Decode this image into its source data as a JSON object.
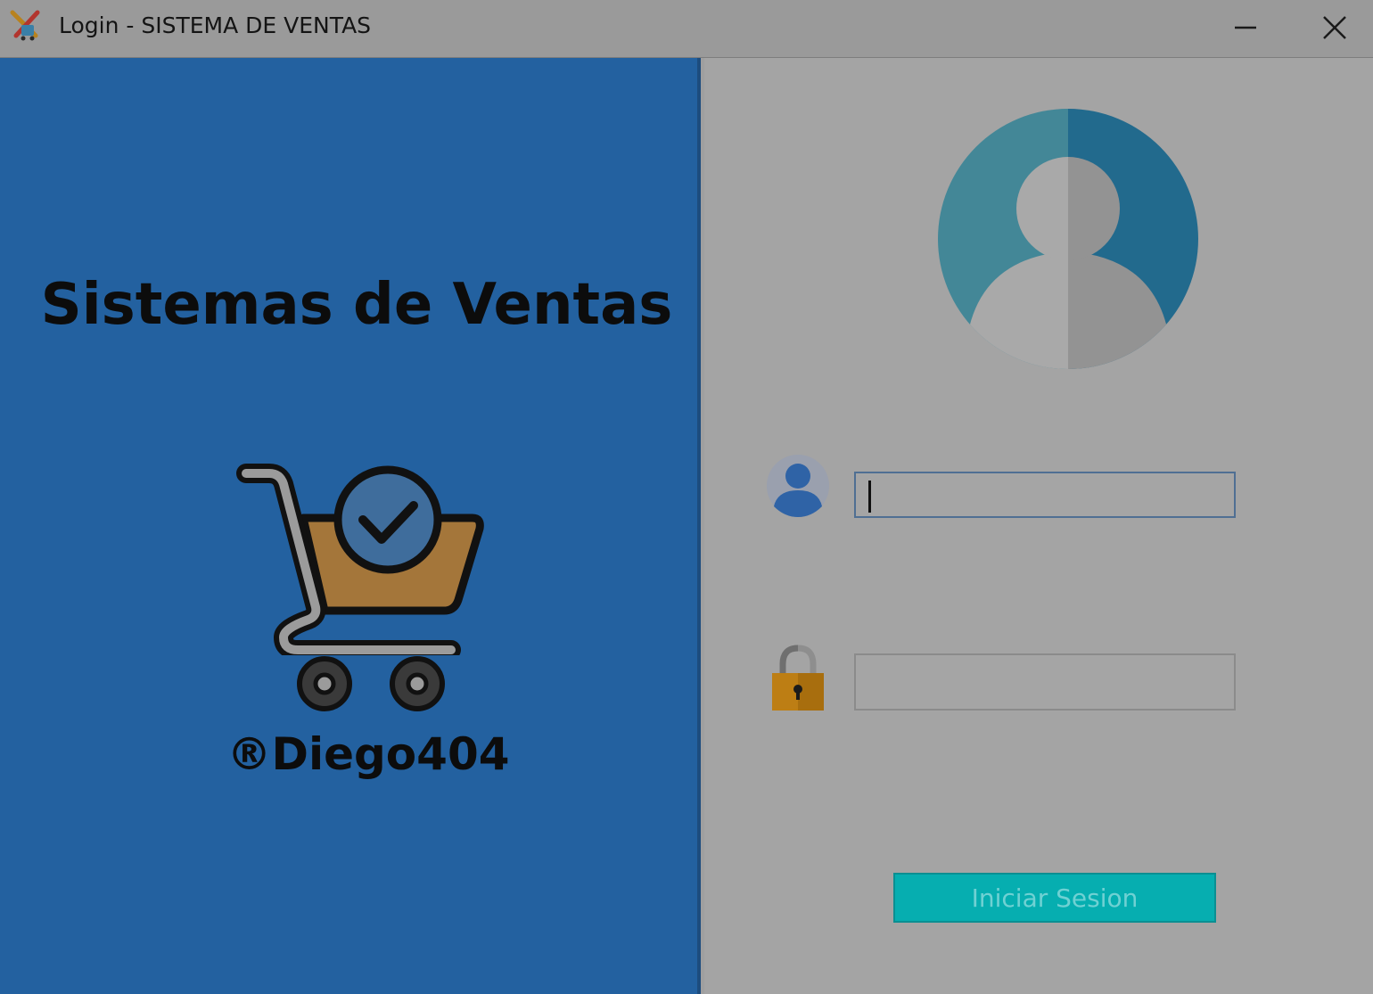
{
  "window": {
    "title": "Login - SISTEMA DE VENTAS",
    "app_icon": "tools-app-icon",
    "controls": [
      "minimize-icon",
      "close-icon"
    ]
  },
  "left_panel": {
    "title": "Sistemas de Ventas",
    "illustration": "shopping-cart-check-icon",
    "credit": "®Diego404",
    "background": "#2361a0"
  },
  "login_form": {
    "avatar": "user-avatar-icon",
    "username": {
      "icon": "user-icon",
      "value": "",
      "placeholder": ""
    },
    "password": {
      "icon": "lock-icon",
      "value": "",
      "placeholder": ""
    },
    "submit_label": "Iniciar Sesion",
    "accent": "#06aeb0"
  }
}
